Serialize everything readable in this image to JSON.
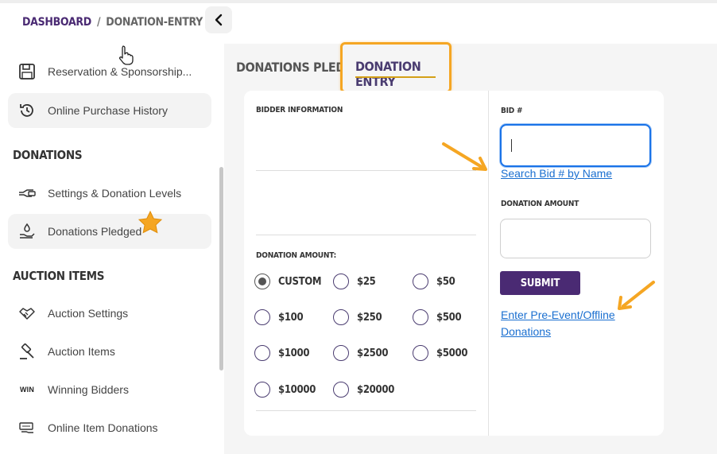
{
  "breadcrumb": {
    "home": "DASHBOARD",
    "separator": "/",
    "current": "DONATION-ENTRY"
  },
  "sidebar": {
    "items_top": [
      {
        "label": "Reservation & Sponsorship...",
        "icon": "floppy-icon"
      },
      {
        "label": "Online Purchase History",
        "icon": "history-icon"
      }
    ],
    "donations_title": "DONATIONS",
    "donations_items": [
      {
        "label": "Settings & Donation Levels",
        "icon": "hand-money-icon"
      },
      {
        "label": "Donations Pledged",
        "icon": "donation-hand-icon"
      }
    ],
    "auction_title": "AUCTION ITEMS",
    "auction_items": [
      {
        "label": "Auction Settings",
        "icon": "handshake-icon"
      },
      {
        "label": "Auction Items",
        "icon": "gavel-icon"
      },
      {
        "label": "Winning Bidders",
        "icon": "win-icon",
        "icon_text": "WIN"
      },
      {
        "label": "Online Item Donations",
        "icon": "donate-sign-icon"
      }
    ]
  },
  "tabs": {
    "pledged": "DONATIONS PLEDGED",
    "entry": "DONATION ENTRY"
  },
  "form": {
    "bidder_info_label": "BIDDER INFORMATION",
    "donation_amount_label": "DONATION AMOUNT:",
    "amount_options": [
      "CUSTOM",
      "$25",
      "$50",
      "$100",
      "$250",
      "$500",
      "$1000",
      "$2500",
      "$5000",
      "$10000",
      "$20000"
    ],
    "selected_option": "CUSTOM",
    "bid_label": "BID #",
    "bid_value": "",
    "search_bid_link": "Search Bid # by Name",
    "right_amount_label": "DONATION AMOUNT",
    "amount_value": "",
    "submit_label": "SUBMIT",
    "pre_event_link": "Enter Pre-Event/Offline Donations"
  },
  "colors": {
    "brand_purple": "#4a2a73",
    "highlight_orange": "#f5a623",
    "link_blue": "#1a6fd0"
  }
}
